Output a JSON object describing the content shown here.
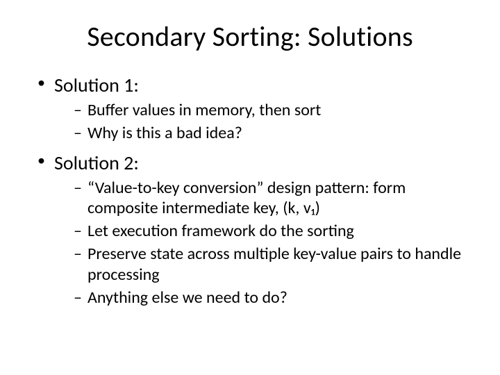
{
  "title": "Secondary Sorting: Solutions",
  "bullets": [
    {
      "label": "Solution 1:",
      "children": [
        "Buffer values in memory, then sort",
        "Why is this a bad idea?"
      ]
    },
    {
      "label": "Solution 2:",
      "children": [
        "“Value-to-key conversion” design pattern: form composite intermediate key, (k, v₁)",
        "Let execution framework do the sorting",
        "Preserve state across multiple key-value pairs to handle processing",
        "Anything else we need to do?"
      ]
    }
  ]
}
